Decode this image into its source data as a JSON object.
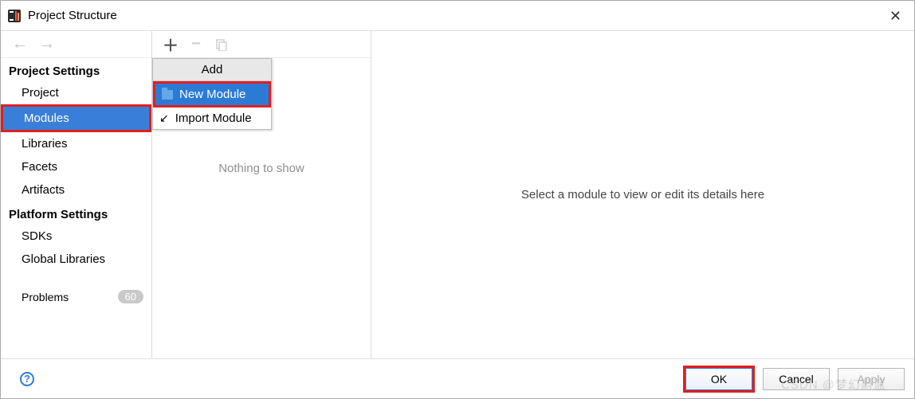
{
  "window": {
    "title": "Project Structure"
  },
  "nav": {
    "section1": "Project Settings",
    "items1": {
      "project": "Project",
      "modules": "Modules",
      "libraries": "Libraries",
      "facets": "Facets",
      "artifacts": "Artifacts"
    },
    "section2": "Platform Settings",
    "items2": {
      "sdks": "SDKs",
      "global": "Global Libraries"
    },
    "problems": {
      "label": "Problems",
      "count": "60"
    }
  },
  "popup": {
    "header": "Add",
    "new_module": "New Module",
    "import_module": "Import Module"
  },
  "mid": {
    "empty": "Nothing to show"
  },
  "details": {
    "placeholder": "Select a module to view or edit its details here"
  },
  "footer": {
    "ok": "OK",
    "cancel": "Cancel",
    "apply": "Apply"
  },
  "watermark": "CSDN @梦幻蔚蓝"
}
